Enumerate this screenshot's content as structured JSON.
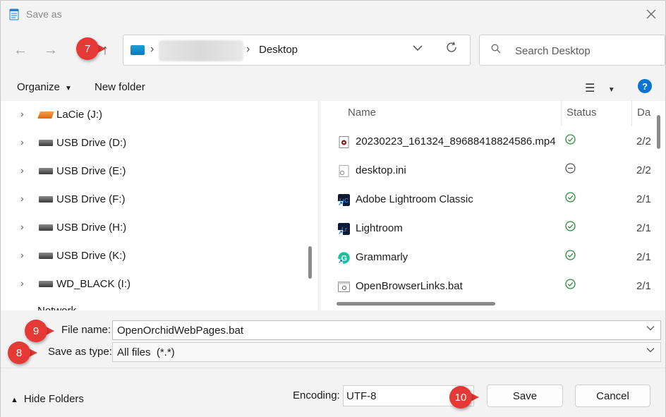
{
  "window": {
    "title": "Save as",
    "close_icon": "close-icon"
  },
  "nav": {
    "back_icon": "←",
    "forward_icon": "→",
    "up_icon": "↑",
    "breadcrumb": "Desktop",
    "search_placeholder": "Search Desktop"
  },
  "toolbar": {
    "organize_label": "Organize",
    "new_folder_label": "New folder",
    "help_label": "?"
  },
  "tree": {
    "items": [
      {
        "label": "LaCie (J:)",
        "kind": "external-drive"
      },
      {
        "label": "USB Drive (D:)",
        "kind": "usb-drive"
      },
      {
        "label": "USB Drive (E:)",
        "kind": "usb-drive"
      },
      {
        "label": "USB Drive (F:)",
        "kind": "usb-drive"
      },
      {
        "label": "USB Drive (H:)",
        "kind": "usb-drive"
      },
      {
        "label": "USB Drive (K:)",
        "kind": "usb-drive"
      },
      {
        "label": "WD_BLACK (I:)",
        "kind": "usb-drive"
      }
    ],
    "peek_label": "Network"
  },
  "files": {
    "columns": {
      "name": "Name",
      "status": "Status",
      "date": "Da"
    },
    "rows": [
      {
        "name": "20230223_161324_89688418824586.mp4",
        "status": "synced",
        "date": "2/2",
        "icon": "video-file-icon"
      },
      {
        "name": "desktop.ini",
        "status": "not-synced",
        "date": "2/2",
        "icon": "settings-file-icon"
      },
      {
        "name": "Adobe Lightroom Classic",
        "status": "synced",
        "date": "2/1",
        "icon": "lightroom-classic-icon"
      },
      {
        "name": "Lightroom",
        "status": "synced",
        "date": "2/1",
        "icon": "lightroom-icon"
      },
      {
        "name": "Grammarly",
        "status": "synced",
        "date": "2/1",
        "icon": "grammarly-icon"
      },
      {
        "name": "OpenBrowserLinks.bat",
        "status": "synced",
        "date": "2/1",
        "icon": "batch-file-icon"
      }
    ]
  },
  "form": {
    "filename_label": "File name:",
    "filename_value": "OpenOrchidWebPages.bat",
    "type_label": "Save as type:",
    "type_value": "All files  (*.*)"
  },
  "footer": {
    "hide_folders_label": "Hide Folders",
    "encoding_label": "Encoding:",
    "encoding_value": "UTF-8",
    "save_label": "Save",
    "cancel_label": "Cancel"
  },
  "badges": {
    "b7": "7",
    "b8": "8",
    "b9": "9",
    "b10": "10"
  },
  "colors": {
    "badge": "#e53935",
    "help": "#0a74d1",
    "status_ok": "#2e8b3a"
  }
}
